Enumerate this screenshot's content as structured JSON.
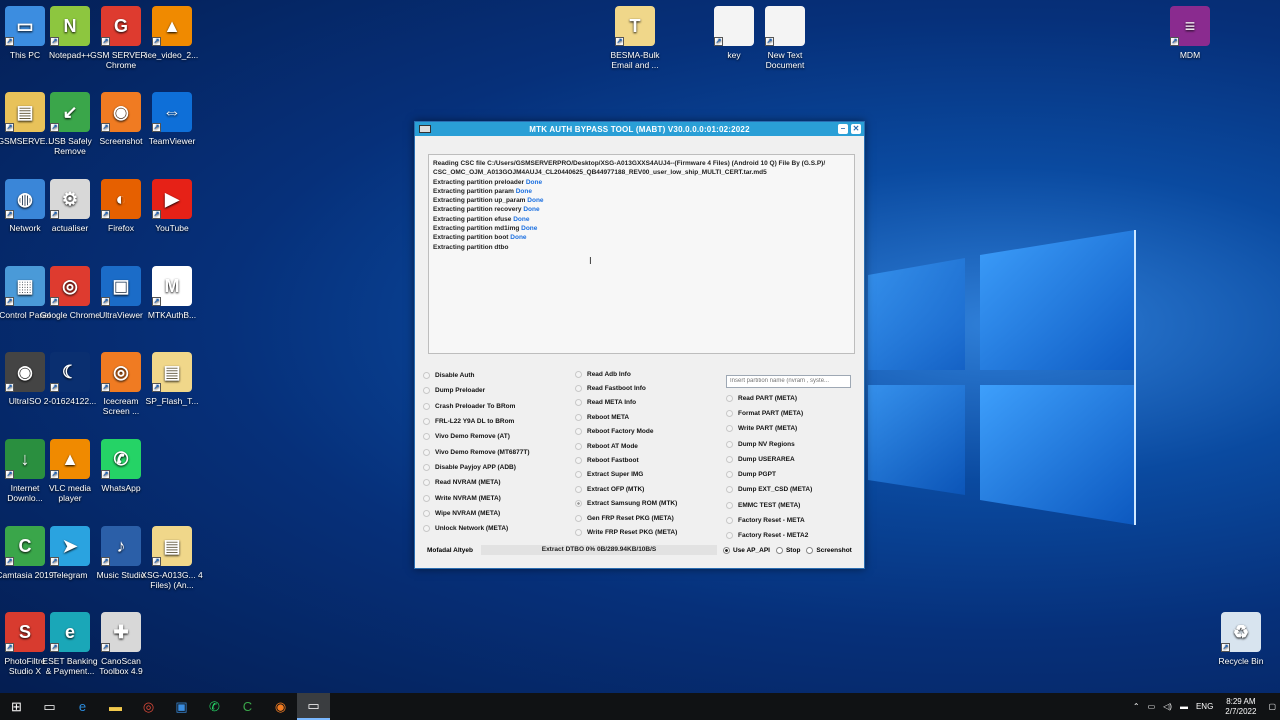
{
  "desktop_icons": [
    {
      "label": "This PC",
      "icon": "computer-icon",
      "color": "#3c8de0",
      "glyph": "▭"
    },
    {
      "label": "Notepad++",
      "icon": "notepad-icon",
      "color": "#8dc63f",
      "glyph": "N"
    },
    {
      "label": "GSM SERVER - Chrome",
      "icon": "chrome-icon",
      "color": "#de3b2f",
      "glyph": "G"
    },
    {
      "label": "ice_video_2...",
      "icon": "vlc-icon",
      "color": "#f08a00",
      "glyph": "▲"
    },
    {
      "label": "GSMSERVE...",
      "icon": "user-folder-icon",
      "color": "#e8c25a",
      "glyph": "▤"
    },
    {
      "label": "USB Safely Remove",
      "icon": "usb-icon",
      "color": "#3aa64a",
      "glyph": "↙"
    },
    {
      "label": "Screenshot",
      "icon": "screenshot-icon",
      "color": "#f07b22",
      "glyph": "◉"
    },
    {
      "label": "TeamViewer",
      "icon": "teamviewer-icon",
      "color": "#0e6fd8",
      "glyph": "⇔"
    },
    {
      "label": "Network",
      "icon": "network-icon",
      "color": "#3a86d8",
      "glyph": "◍"
    },
    {
      "label": "actualiser",
      "icon": "settings-icon",
      "color": "#d8d8d8",
      "glyph": "⚙"
    },
    {
      "label": "Firefox",
      "icon": "firefox-icon",
      "color": "#e66000",
      "glyph": "◐"
    },
    {
      "label": "YouTube",
      "icon": "youtube-icon",
      "color": "#e62117",
      "glyph": "▶"
    },
    {
      "label": "Control Panel",
      "icon": "control-panel-icon",
      "color": "#4a9ad8",
      "glyph": "▦"
    },
    {
      "label": "Google Chrome",
      "icon": "chrome-icon",
      "color": "#de3b2f",
      "glyph": "◎"
    },
    {
      "label": "UltraViewer",
      "icon": "ultraviewer-icon",
      "color": "#1b6cc8",
      "glyph": "▣"
    },
    {
      "label": "MTKAuthB...",
      "icon": "mediatek-icon",
      "color": "#ffffff",
      "glyph": "M"
    },
    {
      "label": "UltraISO",
      "icon": "disc-icon",
      "color": "#444444",
      "glyph": "◉"
    },
    {
      "label": "2-01624122...",
      "icon": "file-icon",
      "color": "#0a2f70",
      "glyph": "☾"
    },
    {
      "label": "Icecream Screen ...",
      "icon": "icecream-icon",
      "color": "#f07b22",
      "glyph": "◎"
    },
    {
      "label": "SP_Flash_T...",
      "icon": "folder-icon",
      "color": "#f0d78a",
      "glyph": "▤"
    },
    {
      "label": "Internet Downlo...",
      "icon": "idm-icon",
      "color": "#2a8f3f",
      "glyph": "↓"
    },
    {
      "label": "VLC media player",
      "icon": "vlc-icon",
      "color": "#f08a00",
      "glyph": "▲"
    },
    {
      "label": "WhatsApp",
      "icon": "whatsapp-icon",
      "color": "#25d366",
      "glyph": "✆"
    },
    {
      "label": "",
      "icon": "empty-slot",
      "color": "transparent",
      "glyph": ""
    },
    {
      "label": "Camtasia 2019",
      "icon": "camtasia-icon",
      "color": "#3aa64a",
      "glyph": "C"
    },
    {
      "label": "Telegram",
      "icon": "telegram-icon",
      "color": "#2aa3e0",
      "glyph": "➤"
    },
    {
      "label": "Music Studio",
      "icon": "music-icon",
      "color": "#2b5fa8",
      "glyph": "♪"
    },
    {
      "label": "XSG-A013G... 4 Files) (An...",
      "icon": "folder-icon",
      "color": "#f0d78a",
      "glyph": "▤"
    },
    {
      "label": "PhotoFiltre Studio X",
      "icon": "photofiltre-icon",
      "color": "#d83b2f",
      "glyph": "S"
    },
    {
      "label": "ESET Banking & Payment...",
      "icon": "eset-icon",
      "color": "#1aa7b8",
      "glyph": "e"
    },
    {
      "label": "CanoScan Toolbox 4.9",
      "icon": "canoscan-icon",
      "color": "#d8d8d8",
      "glyph": "✚"
    }
  ],
  "top_icons": [
    {
      "label": "BESMA-Bulk Email and ...",
      "icon": "document-icon",
      "color": "#f0d78a",
      "glyph": "T"
    },
    {
      "label": "key",
      "icon": "text-file-icon",
      "color": "#f4f4f4",
      "glyph": ""
    },
    {
      "label": "New Text Document",
      "icon": "text-file-icon",
      "color": "#f4f4f4",
      "glyph": ""
    },
    {
      "label": "MDM",
      "icon": "winrar-icon",
      "color": "#8a2b8f",
      "glyph": "≡"
    },
    {
      "label": "Recycle Bin",
      "icon": "recycle-bin-icon",
      "color": "#d8e4ef",
      "glyph": "♻"
    }
  ],
  "window": {
    "title": "MTK AUTH BYPASS TOOL (MABT) V30.0.0.0:01:02:2022",
    "log": [
      {
        "text": "Reading CSC file C:/Users/GSMSERVERPRO/Desktop/XSG-A013GXXS4AUJ4--(Firmware 4 Files) (Android 10 Q) File By (G.S.P)/",
        "status": ""
      },
      {
        "text": "CSC_OMC_OJM_A013GOJM4AUJ4_CL20440625_QB44977188_REV00_user_low_ship_MULTI_CERT.tar.md5",
        "status": ""
      },
      {
        "text": "Extracting partition preloader ",
        "status": "Done"
      },
      {
        "text": "Extracting partition param ",
        "status": "Done"
      },
      {
        "text": "Extracting partition up_param ",
        "status": "Done"
      },
      {
        "text": "Extracting partition recovery ",
        "status": "Done"
      },
      {
        "text": "Extracting partition efuse ",
        "status": "Done"
      },
      {
        "text": "Extracting partition md1img ",
        "status": "Done"
      },
      {
        "text": "Extracting partition boot ",
        "status": "Done"
      },
      {
        "text": "Extracting partition dtbo",
        "status": ""
      }
    ],
    "col1": [
      "Disable Auth",
      "Dump Preloader",
      "Crash Preloader To BRom",
      "FRL-L22 Y9A DL to BRom",
      "Vivo Demo Remove (AT)",
      "Vivo Demo Remove (MT6877T)",
      "Disable Payjoy APP (ADB)",
      "Read NVRAM (META)",
      "Write NVRAM (META)",
      "Wipe NVRAM (META)",
      "Unlock Network (META)"
    ],
    "col2": [
      "Read Adb Info",
      "Read Fastboot Info",
      "Read META Info",
      "Reboot META",
      "Reboot Factory Mode",
      "Reboot AT Mode",
      "Reboot Fastboot",
      "Extract Super IMG",
      "Extract OFP (MTK)",
      "Extract Samsung ROM (MTK)",
      "Gen FRP Reset PKG (META)",
      "Write FRP Reset PKG (META)"
    ],
    "col2_selected_index": 9,
    "partition_placeholder": "Insert partition name (nvram , syste...",
    "col3": [
      "Read PART (META)",
      "Format PART (META)",
      "Write PART (META)",
      "Dump NV Regions",
      "Dump USERAREA",
      "Dump PGPT",
      "Dump  EXT_CSD (META)",
      "EMMC TEST (META)",
      "Factory Reset - META",
      "Factory Reset - META2"
    ],
    "status_author": "Mofadal Altyeb",
    "progress_text": "Extract DTBO 0% 0B/289.94KB/10B/S",
    "progress_fraction": 0.0,
    "status_options": [
      {
        "label": "Use AP_API",
        "checked": true
      },
      {
        "label": "Stop",
        "checked": false
      },
      {
        "label": "Screenshot",
        "checked": false
      }
    ]
  },
  "taskbar": {
    "items": [
      "start-icon",
      "task-view-icon",
      "edge-icon",
      "file-explorer-icon",
      "chrome-icon",
      "ultraviewer-icon",
      "whatsapp-icon",
      "camtasia-icon",
      "icecream-icon",
      "mabt-tool-icon"
    ],
    "language": "ENG",
    "time": "8:29 AM",
    "date": "2/7/2022"
  }
}
